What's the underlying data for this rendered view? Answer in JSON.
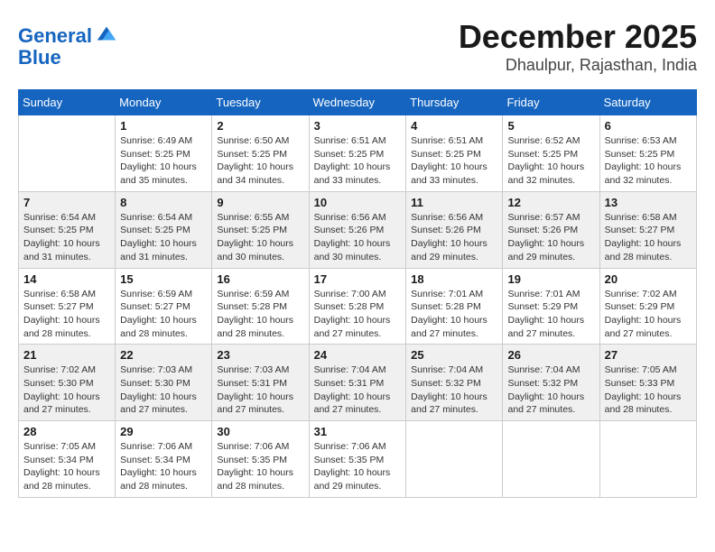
{
  "logo": {
    "line1": "General",
    "line2": "Blue"
  },
  "title": {
    "month": "December 2025",
    "location": "Dhaulpur, Rajasthan, India"
  },
  "calendar": {
    "headers": [
      "Sunday",
      "Monday",
      "Tuesday",
      "Wednesday",
      "Thursday",
      "Friday",
      "Saturday"
    ],
    "weeks": [
      [
        {
          "day": "",
          "info": ""
        },
        {
          "day": "1",
          "info": "Sunrise: 6:49 AM\nSunset: 5:25 PM\nDaylight: 10 hours\nand 35 minutes."
        },
        {
          "day": "2",
          "info": "Sunrise: 6:50 AM\nSunset: 5:25 PM\nDaylight: 10 hours\nand 34 minutes."
        },
        {
          "day": "3",
          "info": "Sunrise: 6:51 AM\nSunset: 5:25 PM\nDaylight: 10 hours\nand 33 minutes."
        },
        {
          "day": "4",
          "info": "Sunrise: 6:51 AM\nSunset: 5:25 PM\nDaylight: 10 hours\nand 33 minutes."
        },
        {
          "day": "5",
          "info": "Sunrise: 6:52 AM\nSunset: 5:25 PM\nDaylight: 10 hours\nand 32 minutes."
        },
        {
          "day": "6",
          "info": "Sunrise: 6:53 AM\nSunset: 5:25 PM\nDaylight: 10 hours\nand 32 minutes."
        }
      ],
      [
        {
          "day": "7",
          "info": "Sunrise: 6:54 AM\nSunset: 5:25 PM\nDaylight: 10 hours\nand 31 minutes."
        },
        {
          "day": "8",
          "info": "Sunrise: 6:54 AM\nSunset: 5:25 PM\nDaylight: 10 hours\nand 31 minutes."
        },
        {
          "day": "9",
          "info": "Sunrise: 6:55 AM\nSunset: 5:25 PM\nDaylight: 10 hours\nand 30 minutes."
        },
        {
          "day": "10",
          "info": "Sunrise: 6:56 AM\nSunset: 5:26 PM\nDaylight: 10 hours\nand 30 minutes."
        },
        {
          "day": "11",
          "info": "Sunrise: 6:56 AM\nSunset: 5:26 PM\nDaylight: 10 hours\nand 29 minutes."
        },
        {
          "day": "12",
          "info": "Sunrise: 6:57 AM\nSunset: 5:26 PM\nDaylight: 10 hours\nand 29 minutes."
        },
        {
          "day": "13",
          "info": "Sunrise: 6:58 AM\nSunset: 5:27 PM\nDaylight: 10 hours\nand 28 minutes."
        }
      ],
      [
        {
          "day": "14",
          "info": "Sunrise: 6:58 AM\nSunset: 5:27 PM\nDaylight: 10 hours\nand 28 minutes."
        },
        {
          "day": "15",
          "info": "Sunrise: 6:59 AM\nSunset: 5:27 PM\nDaylight: 10 hours\nand 28 minutes."
        },
        {
          "day": "16",
          "info": "Sunrise: 6:59 AM\nSunset: 5:28 PM\nDaylight: 10 hours\nand 28 minutes."
        },
        {
          "day": "17",
          "info": "Sunrise: 7:00 AM\nSunset: 5:28 PM\nDaylight: 10 hours\nand 27 minutes."
        },
        {
          "day": "18",
          "info": "Sunrise: 7:01 AM\nSunset: 5:28 PM\nDaylight: 10 hours\nand 27 minutes."
        },
        {
          "day": "19",
          "info": "Sunrise: 7:01 AM\nSunset: 5:29 PM\nDaylight: 10 hours\nand 27 minutes."
        },
        {
          "day": "20",
          "info": "Sunrise: 7:02 AM\nSunset: 5:29 PM\nDaylight: 10 hours\nand 27 minutes."
        }
      ],
      [
        {
          "day": "21",
          "info": "Sunrise: 7:02 AM\nSunset: 5:30 PM\nDaylight: 10 hours\nand 27 minutes."
        },
        {
          "day": "22",
          "info": "Sunrise: 7:03 AM\nSunset: 5:30 PM\nDaylight: 10 hours\nand 27 minutes."
        },
        {
          "day": "23",
          "info": "Sunrise: 7:03 AM\nSunset: 5:31 PM\nDaylight: 10 hours\nand 27 minutes."
        },
        {
          "day": "24",
          "info": "Sunrise: 7:04 AM\nSunset: 5:31 PM\nDaylight: 10 hours\nand 27 minutes."
        },
        {
          "day": "25",
          "info": "Sunrise: 7:04 AM\nSunset: 5:32 PM\nDaylight: 10 hours\nand 27 minutes."
        },
        {
          "day": "26",
          "info": "Sunrise: 7:04 AM\nSunset: 5:32 PM\nDaylight: 10 hours\nand 27 minutes."
        },
        {
          "day": "27",
          "info": "Sunrise: 7:05 AM\nSunset: 5:33 PM\nDaylight: 10 hours\nand 28 minutes."
        }
      ],
      [
        {
          "day": "28",
          "info": "Sunrise: 7:05 AM\nSunset: 5:34 PM\nDaylight: 10 hours\nand 28 minutes."
        },
        {
          "day": "29",
          "info": "Sunrise: 7:06 AM\nSunset: 5:34 PM\nDaylight: 10 hours\nand 28 minutes."
        },
        {
          "day": "30",
          "info": "Sunrise: 7:06 AM\nSunset: 5:35 PM\nDaylight: 10 hours\nand 28 minutes."
        },
        {
          "day": "31",
          "info": "Sunrise: 7:06 AM\nSunset: 5:35 PM\nDaylight: 10 hours\nand 29 minutes."
        },
        {
          "day": "",
          "info": ""
        },
        {
          "day": "",
          "info": ""
        },
        {
          "day": "",
          "info": ""
        }
      ]
    ]
  }
}
